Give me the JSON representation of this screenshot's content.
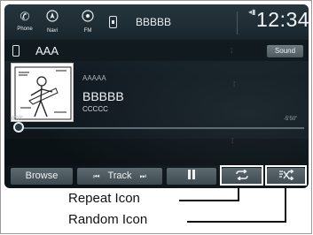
{
  "top_bar": {
    "phone_label": "Phone",
    "navi_label": "Navi",
    "fm_label": "FM",
    "now_playing": "BBBBB",
    "clock": "12:34"
  },
  "source_row": {
    "source_name": "AAA",
    "sound_label": "Sound"
  },
  "track": {
    "line1": "AAAAA",
    "line2": "BBBBB",
    "line3": "CCCCC",
    "elapsed": "0'03\"",
    "remaining": "-5'50\"",
    "progress": 0.01
  },
  "controls": {
    "browse_label": "Browse",
    "track_label": "Track",
    "prev_icon": "skip-back-icon",
    "next_icon": "skip-forward-icon",
    "pause_icon": "pause-icon",
    "repeat_icon": "repeat-icon",
    "random_icon": "shuffle-icon"
  },
  "callouts": {
    "repeat": "Repeat Icon",
    "random": "Random Icon"
  }
}
